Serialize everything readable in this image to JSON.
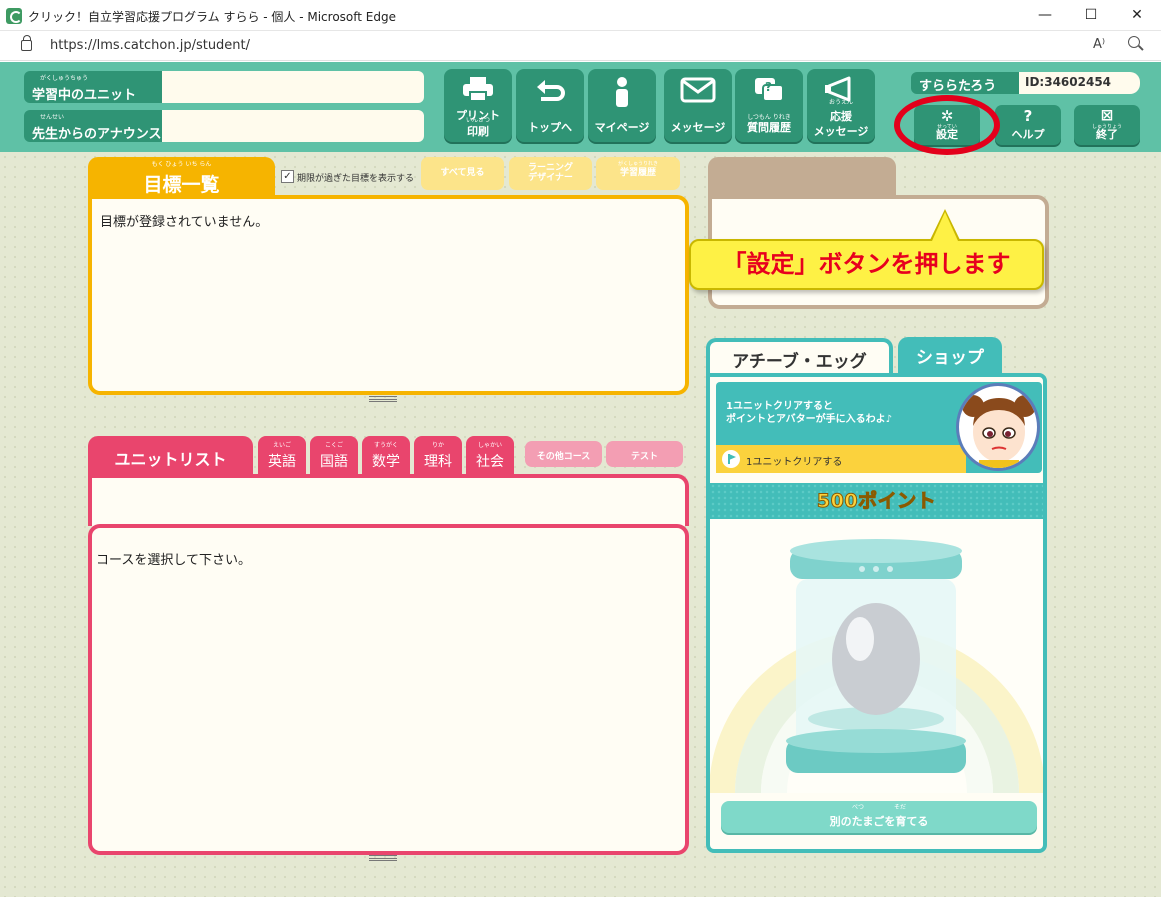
{
  "window": {
    "title": "クリック！自立学習応援プログラム すらら - 個人 - Microsoft Edge",
    "url": "https://lms.catchon.jp/student/",
    "minimize": "—",
    "maximize": "☐",
    "close": "✕",
    "read_aloud": "A⁾"
  },
  "header": {
    "unit_label": "学習中のユニット",
    "unit_ruby": "がくしゅうちゅう",
    "announce_label": "先生からのアナウンス",
    "announce_ruby": "せんせい",
    "nav": {
      "print_top": "プリント",
      "print_ruby": "いんさつ",
      "print_bottom": "印刷",
      "top": "トップへ",
      "mypage": "マイページ",
      "message": "メッセージ",
      "question_ruby": "しつもん りれき",
      "question": "質問履歴",
      "cheer_ruby": "おうえん",
      "cheer_top": "応援",
      "cheer_bottom": "メッセージ"
    },
    "user_name": "すららたろう",
    "user_id": "ID:34602454",
    "settings_ruby": "せってい",
    "settings": "設定",
    "help_glyph": "?",
    "help": "ヘルプ",
    "exit_ruby": "しゅうりょう",
    "exit": "終了"
  },
  "goals": {
    "tab": "目標一覧",
    "tab_ruby": "もく ひょう いち らん",
    "show_expired": "期限が過ぎた目標を表示する",
    "checkmark": "✓",
    "see_all": "すべて見る",
    "designer_line1": "ラーニング",
    "designer_line2": "デザイナー",
    "history_ruby": "がくしゅうりれき",
    "history": "学習履歴",
    "empty": "目標が登録されていません。"
  },
  "units": {
    "tab": "ユニットリスト",
    "subjects": [
      {
        "label": "英語",
        "ruby": "えいご"
      },
      {
        "label": "国語",
        "ruby": "こくご"
      },
      {
        "label": "数学",
        "ruby": "すうがく"
      },
      {
        "label": "理科",
        "ruby": "りか"
      },
      {
        "label": "社会",
        "ruby": "しゃかい"
      }
    ],
    "other_course": "その他コース",
    "test": "テスト",
    "empty": "コースを選択して下さい。"
  },
  "egg": {
    "tab_achieve": "アチーブ・エッグ",
    "tab_shop": "ショップ",
    "mission_line1": "1ユニットクリアすると",
    "mission_line2": "ポイントとアバターが手に入るわよ♪",
    "mission_task": "1ユニットクリアする",
    "points": "500ポイント",
    "grow_ruby": "べつ　　　　　そだ",
    "grow": "別のたまごを育てる"
  },
  "callout": "「設定」ボタンを押します",
  "colors": {
    "header_green": "#5fc1a6",
    "button_green": "#2f9475",
    "goal_yellow": "#f6b400",
    "unit_pink": "#e9456d",
    "egg_teal": "#43bdb9",
    "highlight_red": "#e3001b",
    "callout_yellow": "#fef145"
  }
}
